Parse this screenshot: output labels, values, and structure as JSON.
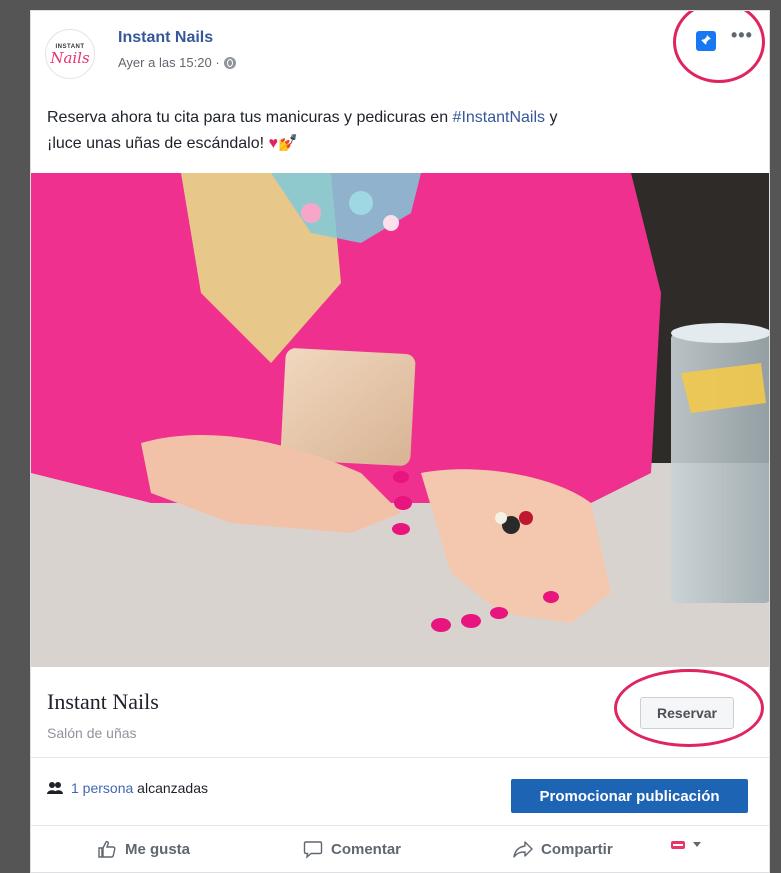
{
  "post": {
    "page_name": "Instant Nails",
    "timestamp": "Ayer a las 15:20 ·",
    "avatar_top": "INSTANT",
    "avatar_script": "Nails",
    "text_part1": "Reserva ahora tu cita para tus manicuras y pedicuras en ",
    "hashtag": "#InstantNails",
    "text_part2": " y",
    "text_line2": "¡luce unas uñas de escándalo! ",
    "emoji_heart": "♥",
    "emoji_nail": "💅",
    "more_icon": "•••"
  },
  "link_preview": {
    "title": "Instant Nails",
    "subtitle": "Salón de uñas",
    "cta_label": "Reservar"
  },
  "reach": {
    "count_link": "1 persona",
    "suffix": " alcanzadas",
    "promote_label": "Promocionar publicación"
  },
  "actions": {
    "like": "Me gusta",
    "comment": "Comentar",
    "share": "Compartir"
  },
  "colors": {
    "accent_blue": "#365899",
    "button_blue": "#1e64b4",
    "highlight_circle": "#e0245e"
  }
}
